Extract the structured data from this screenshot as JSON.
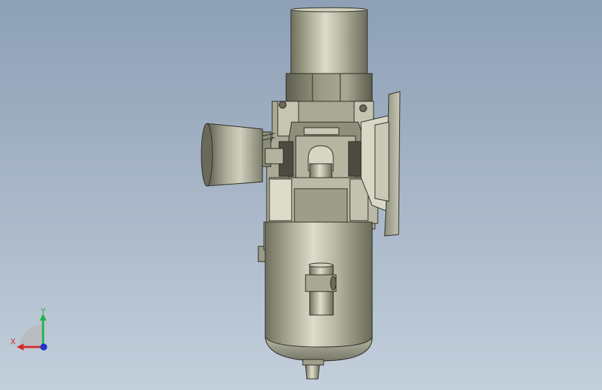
{
  "viewport": {
    "background_top": "#8da0b6",
    "background_bottom": "#c3cfdb",
    "model_color": "#b3b39e"
  },
  "triad": {
    "y_label": "Y",
    "x_label": "X",
    "y_color": "#22b24a",
    "x_color": "#d42a2a",
    "z_color": "#2233cc"
  }
}
